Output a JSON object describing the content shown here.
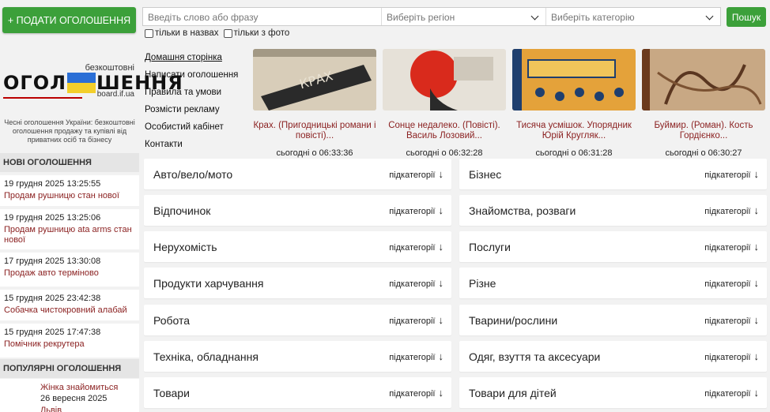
{
  "header": {
    "post_button": "+ ПОДАТИ ОГОЛОШЕННЯ",
    "search_placeholder": "Введіть слово або фразу",
    "region_placeholder": "Виберіть регіон",
    "category_placeholder": "Виберіть категорію",
    "search_button": "Пошук",
    "check_titles": "тільки в назвах",
    "check_photo": "тільки з фото"
  },
  "logo": {
    "top": "безкоштовні",
    "left": "ОГОЛ",
    "right": "ШЕННЯ",
    "sub": "board.if.ua",
    "tagline": "Чесні оголошення України: безкоштовні оголошення продажу та купівлі від приватних осіб та бізнесу",
    "flag_colors": [
      "#2b6fd6",
      "#f3cf2b"
    ]
  },
  "nav": [
    "Домашня сторінка",
    "Написати оголошення",
    "Правила та умови",
    "Розмісти рекламу",
    "Особистий кабінет",
    "Контакти"
  ],
  "sidebar": {
    "new_heading": "НОВІ ОГОЛОШЕННЯ",
    "new_items": [
      {
        "date": "19 грудня 2025 13:25:55",
        "title": "Продам рушницю стан нової"
      },
      {
        "date": "19 грудня 2025 13:25:06",
        "title": "Продам рушницю ata arms стан нової"
      },
      {
        "date": "17 грудня 2025 13:30:08",
        "title": "Продаж авто терміново"
      },
      {
        "date": "15 грудня 2025 23:42:38",
        "title": "Собачка чистокровний алабай"
      },
      {
        "date": "15 грудня 2025 17:47:38",
        "title": "Помічник рекрутера"
      }
    ],
    "popular_heading": "ПОПУЛЯРНІ ОГОЛОШЕННЯ",
    "popular_item": {
      "title": "Жінка знайомиться",
      "date": "26 вересня 2025",
      "location": "Львів"
    }
  },
  "cards": [
    {
      "caption": "Крах. (Пригодницькі романи і повісті)...",
      "time": "сьогодні о 06:33:36"
    },
    {
      "caption": "Сонце недалеко. (Повісті). Василь Лозовий...",
      "time": "сьогодні о 06:32:28"
    },
    {
      "caption": "Тисяча усмішок. Упорядник Юрій Кругляк...",
      "time": "сьогодні о 06:31:28"
    },
    {
      "caption": "Буймир. (Роман). Кость Гордієнко...",
      "time": "сьогодні о 06:30:27"
    }
  ],
  "categories_left": [
    "Авто/вело/мото",
    "Відпочинок",
    "Нерухомість",
    "Продукти харчування",
    "Робота",
    "Техніка, обладнання",
    "Товари"
  ],
  "categories_right": [
    "Бізнес",
    "Знайомства, розваги",
    "Послуги",
    "Різне",
    "Тварини/рослини",
    "Одяг, взуття та аксесуари",
    "Товари для дітей"
  ],
  "subcat_label": "підкатегорії",
  "subcat_arrow": "↓",
  "accent_color": "#3ca03a",
  "link_color": "#8a1f1f"
}
